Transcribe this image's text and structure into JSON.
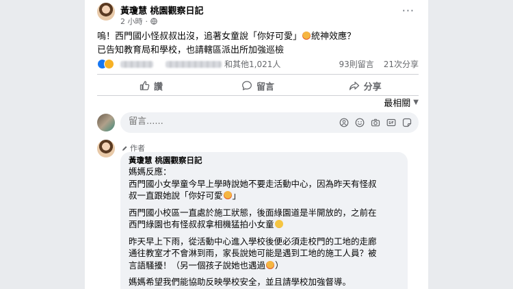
{
  "post": {
    "page_name": "黃瓊慧 桃園觀察日記",
    "time": "2 小時",
    "more_label": "···",
    "close_label": "✕",
    "text_line1_before": "嗚！西門國小怪叔叔出沒，追著女童說「你好可愛」",
    "text_line1_after": "統神效應？",
    "text_line2": "已告知教育局和學校，也請轄區派出所加強巡檢"
  },
  "reactions": {
    "and_others": "和其他1,021人",
    "comments_count": "93則留言",
    "shares_count": "21次分享"
  },
  "actions": {
    "like": "讚",
    "comment": "留言",
    "share": "分享"
  },
  "sort": {
    "label": "最相關"
  },
  "comment_input": {
    "placeholder": "留言......"
  },
  "reply": {
    "badge": "作者",
    "author": "黃瓊慧 桃園觀察日記",
    "line1": "媽媽反應：",
    "para1_a": "西門國小女學童今早上學時說她不要走活動中心，因為昨天有怪叔",
    "para1_b": "叔一直跟她說「你好可愛",
    "para1_c": "」",
    "para2_a": "西門國小校區一直處於施工狀態，後面綠園道是半開放的，之前在",
    "para2_b": "西門綠園也有怪叔叔拿相機猛拍小女童",
    "para3_a": "昨天早上下雨，從活動中心進入學校後便必須走校門的工地的走廊",
    "para3_b": "通往教室才不會淋到雨，家長說她可能是遇到工地的施工人員？被",
    "para3_c": "言語騷擾！（另一個孩子說她也遇過",
    "para3_d": "）",
    "para4": "媽媽希望我們能協助反映學校安全，並且請學校加強督導。"
  },
  "colors": {
    "background": "#e9ebee",
    "card": "#ffffff",
    "secondary_text": "#65676b",
    "like_blue": "#1877f2",
    "bubble": "#f0f2f5"
  }
}
